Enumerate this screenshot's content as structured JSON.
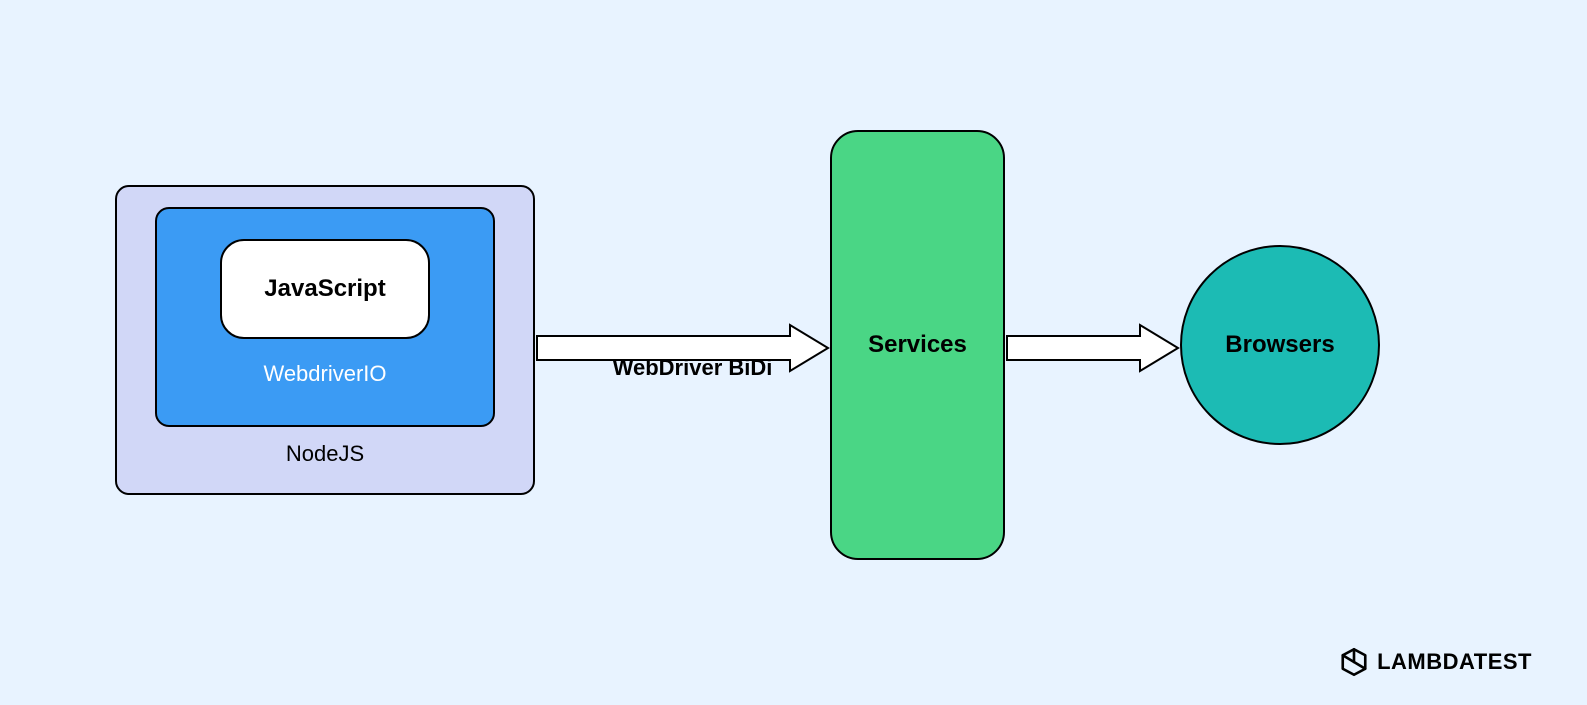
{
  "stack": {
    "outer_label": "NodeJS",
    "middle_label": "WebdriverIO",
    "inner_label": "JavaScript"
  },
  "protocol_label": "WebDriver BiDi",
  "services_label": "Services",
  "browsers_label": "Browsers",
  "branding": {
    "name": "LAMBDATEST"
  },
  "colors": {
    "background": "#e8f3ff",
    "nodejs_box": "#d1d7f7",
    "webdriverio_box": "#3b9bf4",
    "javascript_box": "#ffffff",
    "services_box": "#4ad685",
    "browsers_circle": "#1cbbb4"
  }
}
